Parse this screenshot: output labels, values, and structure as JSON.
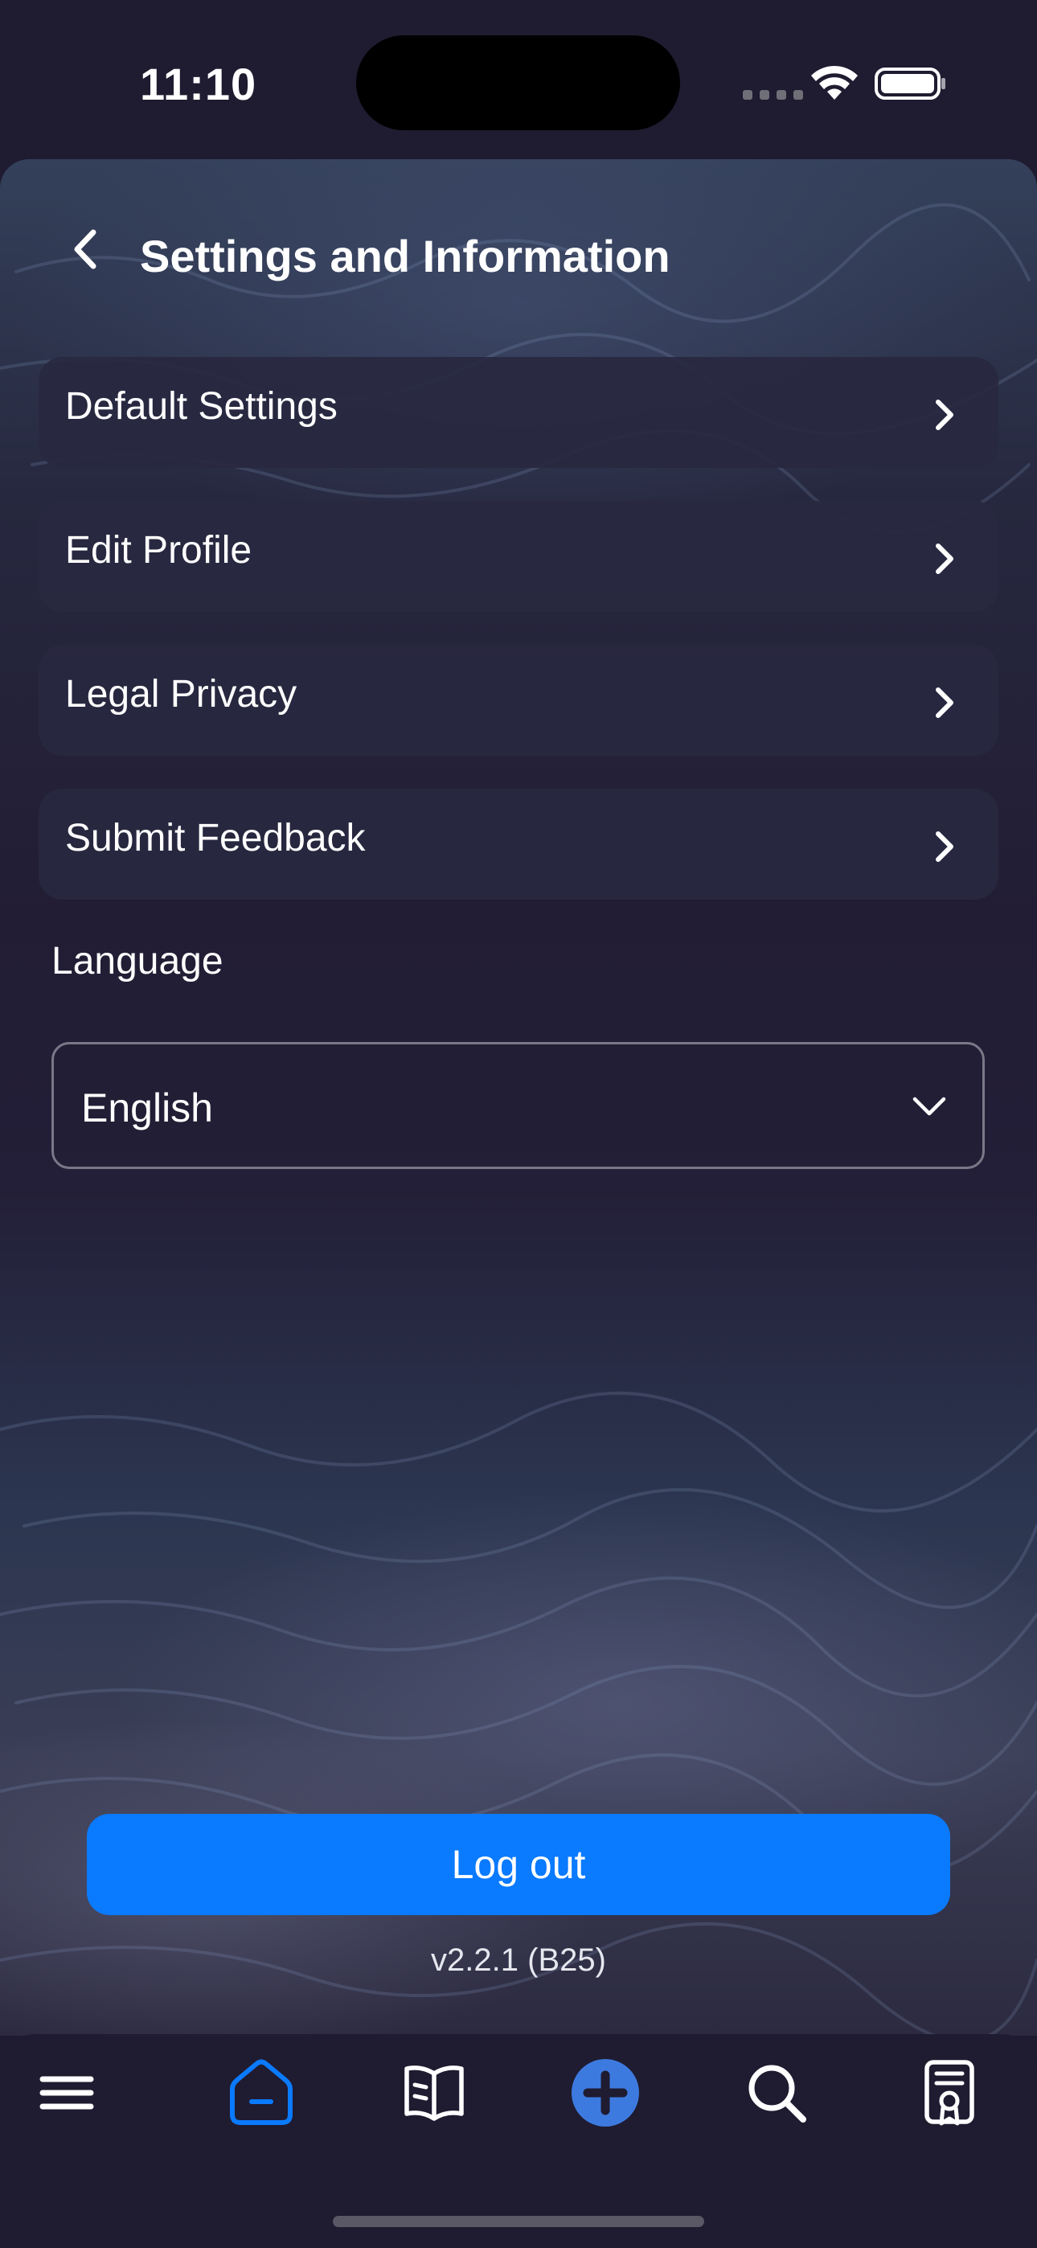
{
  "status_bar": {
    "time": "11:10"
  },
  "header": {
    "title": "Settings and Information"
  },
  "menu": {
    "items": [
      {
        "label": "Default Settings"
      },
      {
        "label": "Edit Profile"
      },
      {
        "label": "Legal Privacy"
      },
      {
        "label": "Submit Feedback"
      }
    ]
  },
  "language": {
    "label": "Language",
    "selected": "English"
  },
  "logout": {
    "label": "Log out"
  },
  "app": {
    "version": "v2.2.1 (B25)"
  },
  "tabbar": {
    "tabs": [
      {
        "icon": "hamburger-menu-icon"
      },
      {
        "icon": "home-icon",
        "active": true
      },
      {
        "icon": "book-icon"
      },
      {
        "icon": "add-circle-icon"
      },
      {
        "icon": "search-icon"
      },
      {
        "icon": "certificate-icon"
      }
    ]
  },
  "colors": {
    "accent": "#0a7aff",
    "background": "#1f1b30",
    "card": "#282840",
    "add_button": "#3d7ae0"
  }
}
